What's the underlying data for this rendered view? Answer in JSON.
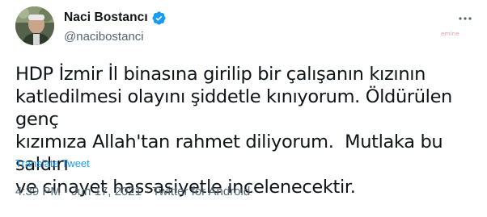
{
  "author": {
    "display_name": "Naci Bostancı",
    "handle": "@nacibostanci",
    "verified": true
  },
  "watermark": "emine",
  "tweet": {
    "text": "HDP İzmir İl binasına girilip bir çalışanın kızının\nkatledilmesi olayını şiddetle kınıyorum. Öldürülen genç\nkızımıza Allah'tan rahmet diliyorum.  Mutlaka bu saldırı\nve cinayet hassasiyetle incelenecektir.",
    "translate_label": "Translate Tweet",
    "time": "4:39 PM",
    "separator": " · ",
    "date": "Jun 17, 2021",
    "source": "Twitter for Android"
  },
  "colors": {
    "accent": "#1d9bf0",
    "secondary_text": "#536471",
    "primary_text": "#0f1419"
  },
  "icons": {
    "verified": "verified-badge-icon",
    "more": "more-horizontal-icon"
  }
}
